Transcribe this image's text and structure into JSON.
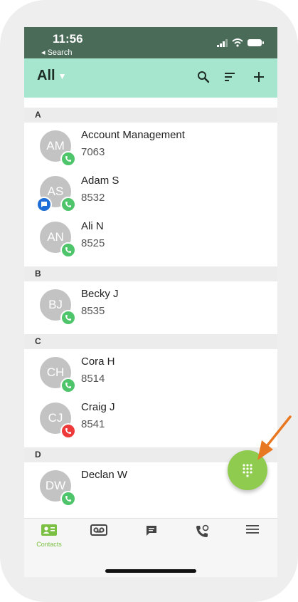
{
  "status": {
    "time": "11:56",
    "back_label": "◂ Search"
  },
  "header": {
    "filter_label": "All"
  },
  "sections": [
    {
      "letter": "A",
      "contacts": [
        {
          "initials": "AM",
          "name": "Account Management",
          "ext": "7063",
          "status": "available",
          "chat": false
        },
        {
          "initials": "AS",
          "name": "Adam S",
          "ext": "8532",
          "status": "available",
          "chat": true
        },
        {
          "initials": "AN",
          "name": "Ali N",
          "ext": "8525",
          "status": "available",
          "chat": false
        }
      ]
    },
    {
      "letter": "B",
      "contacts": [
        {
          "initials": "BJ",
          "name": "Becky J",
          "ext": "8535",
          "status": "available",
          "chat": false
        }
      ]
    },
    {
      "letter": "C",
      "contacts": [
        {
          "initials": "CH",
          "name": "Cora H",
          "ext": "8514",
          "status": "available",
          "chat": false
        },
        {
          "initials": "CJ",
          "name": "Craig J",
          "ext": "8541",
          "status": "busy",
          "chat": false
        }
      ]
    },
    {
      "letter": "D",
      "contacts": [
        {
          "initials": "DW",
          "name": "Declan W",
          "ext": "",
          "status": "available",
          "chat": false
        }
      ]
    }
  ],
  "nav": {
    "contacts_label": "Contacts",
    "active": "contacts"
  },
  "colors": {
    "header_bg": "#a6e6cf",
    "statusbar_bg": "#4a6b58",
    "accent": "#8fcb4f",
    "arrow": "#e87722",
    "available": "#4fc56b",
    "busy": "#ee3a3a",
    "chat": "#1f6ed8"
  },
  "icons": [
    "search-icon",
    "sort-icon",
    "add-icon",
    "dialpad-icon",
    "contacts-icon",
    "voicemail-icon",
    "messages-icon",
    "call-history-icon",
    "menu-icon"
  ]
}
